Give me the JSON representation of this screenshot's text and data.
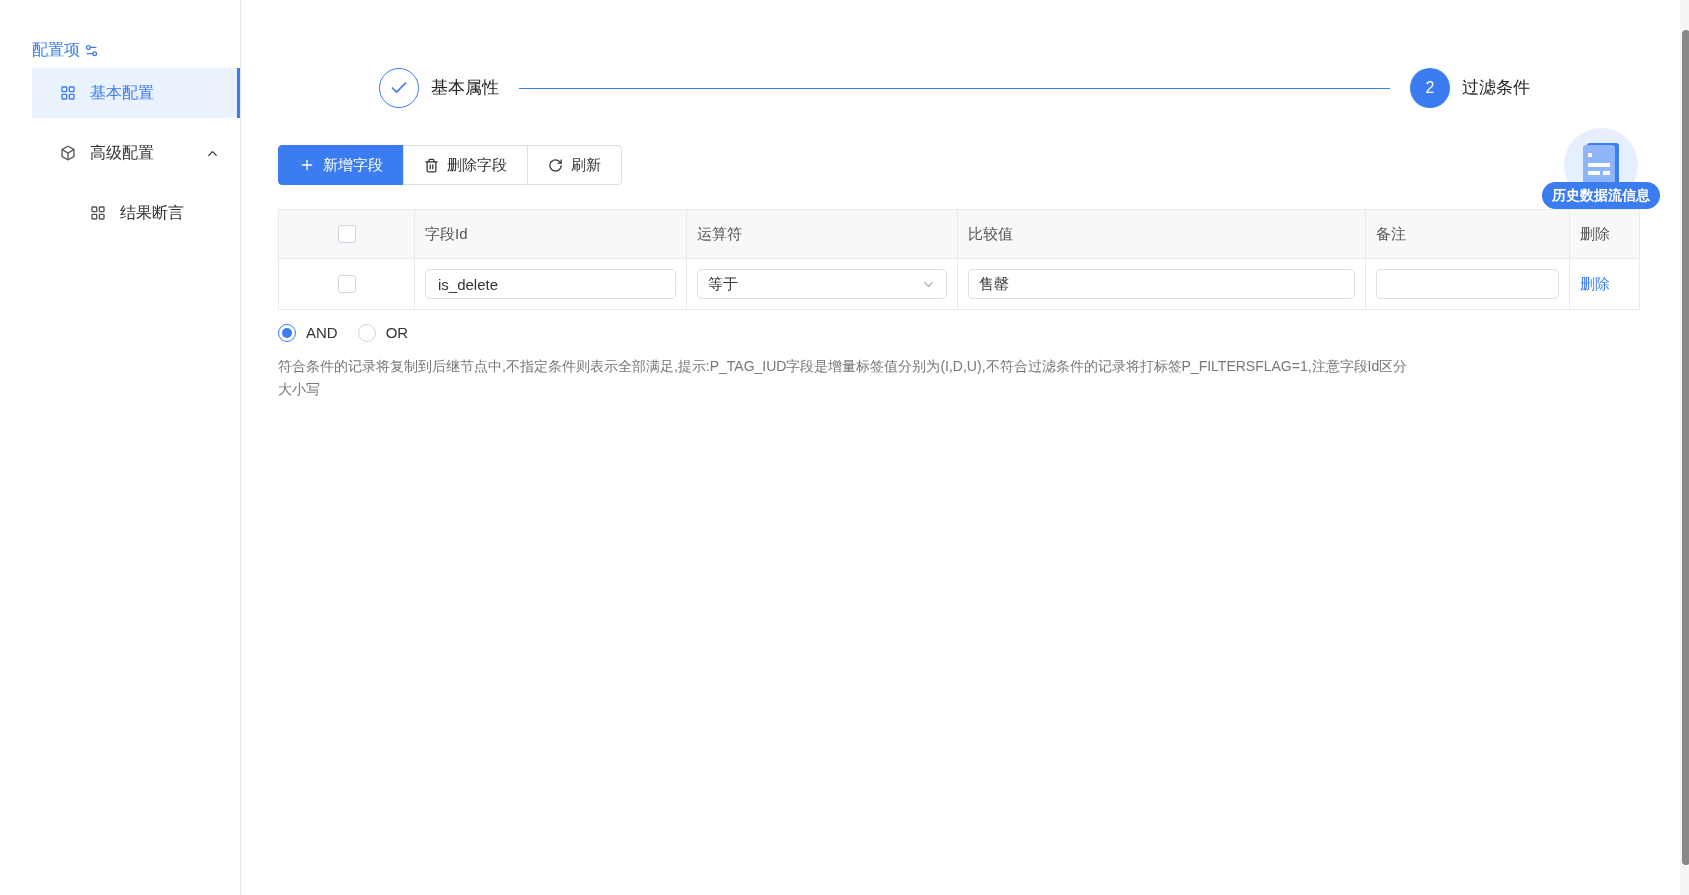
{
  "sidebar": {
    "title": "配置项",
    "items": [
      {
        "label": "基本配置",
        "kind": "grid",
        "selected": true
      },
      {
        "label": "高级配置",
        "kind": "cube",
        "selected": false,
        "expanded": true,
        "children": [
          {
            "label": "结果断言",
            "kind": "grid",
            "selected": false
          }
        ]
      }
    ]
  },
  "steps": [
    {
      "label": "基本属性",
      "done": true
    },
    {
      "number": "2",
      "label": "过滤条件",
      "done": false
    }
  ],
  "toolbar": [
    {
      "label": "新增字段",
      "kind": "plus",
      "primary": true
    },
    {
      "label": "删除字段",
      "kind": "trash",
      "primary": false
    },
    {
      "label": "刷新",
      "kind": "refresh",
      "primary": false
    }
  ],
  "table": {
    "select_all_checked": false,
    "columns": [
      "字段Id",
      "运算符",
      "比较值",
      "备注",
      "删除"
    ],
    "rows": [
      {
        "checked": false,
        "field_id": "is_delete",
        "operator": "等于",
        "value": "售罄",
        "note": "",
        "action": "删除"
      }
    ]
  },
  "logic": [
    {
      "label": "AND",
      "selected": true
    },
    {
      "label": "OR",
      "selected": false
    }
  ],
  "hint": "符合条件的记录将复制到后继节点中,不指定条件则表示全部满足,提示:P_TAG_IUD字段是增量标签值分别为(I,D,U),不符合过滤条件的记录将打标签P_FILTERSFLAG=1,注意字段Id区分大小写",
  "floating_badge": "历史数据流信息"
}
